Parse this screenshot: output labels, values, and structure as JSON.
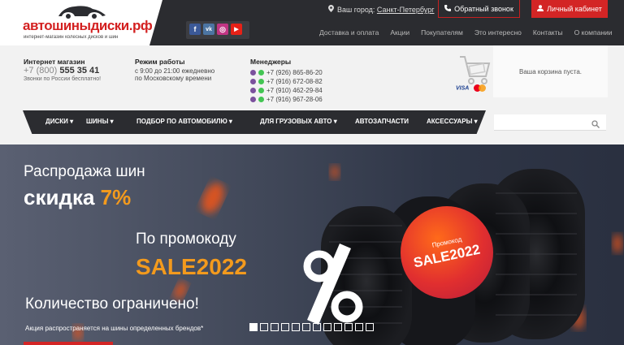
{
  "header": {
    "logo_text": "автошиныдиски.рф",
    "logo_sub": "интернет-магазин колесных дисков и шин",
    "city_label": "Ваш город:",
    "city_value": "Санкт-Петербург",
    "callback_label": "Обратный звонок",
    "cabinet_label": "Личный кабинет",
    "nav": [
      "Доставка и оплата",
      "Акции",
      "Покупателям",
      "Это интересно",
      "Контакты",
      "О компании"
    ],
    "socials": [
      {
        "name": "facebook-icon",
        "glyph": "f",
        "color": "#3b5998"
      },
      {
        "name": "vk-icon",
        "glyph": "vk",
        "color": "#4c75a3"
      },
      {
        "name": "instagram-icon",
        "glyph": "◎",
        "color": "#c13584"
      },
      {
        "name": "youtube-icon",
        "glyph": "▶",
        "color": "#e62117"
      }
    ]
  },
  "info": {
    "shop_title": "Интернет магазин",
    "phone_prefix": "+7 (800)",
    "phone_number": "555 35 41",
    "phone_note": "Звонки по России бесплатно!",
    "hours_title": "Режим работы",
    "hours_line1": "с 9:00 до 21:00 ежедневно",
    "hours_line2": "по Московскому времени",
    "managers_title": "Менеджеры",
    "managers": [
      "+7 (926) 865-86-20",
      "+7 (916) 672-08-82",
      "+7 (910) 462-29-84",
      "+7 (916) 967-28-06"
    ],
    "cards_text": "VISA",
    "cart_text": "Ваша корзина пуста."
  },
  "mainnav": {
    "items": [
      "ДИСКИ",
      "ШИНЫ",
      "ПОДБОР ПО АВТОМОБИЛЮ",
      "ДЛЯ ГРУЗОВЫХ АВТО",
      "АВТОЗАПЧАСТИ",
      "АКСЕССУАРЫ"
    ],
    "search_placeholder": ""
  },
  "banner": {
    "line1": "Распродажа шин",
    "line2_text": "скидка ",
    "line2_pct": "7%",
    "line3": "По промокоду",
    "line4": "SALE2022",
    "line5": "Количество ограничено!",
    "note": "Акция распространяется на шины определенных брендов*",
    "badge_small": "Промокод",
    "badge_big": "SALE2022",
    "slides_count": 12,
    "active_slide": 1
  },
  "colors": {
    "accent": "#d32525",
    "orange": "#f39a1d",
    "dark": "#2b2c30"
  }
}
